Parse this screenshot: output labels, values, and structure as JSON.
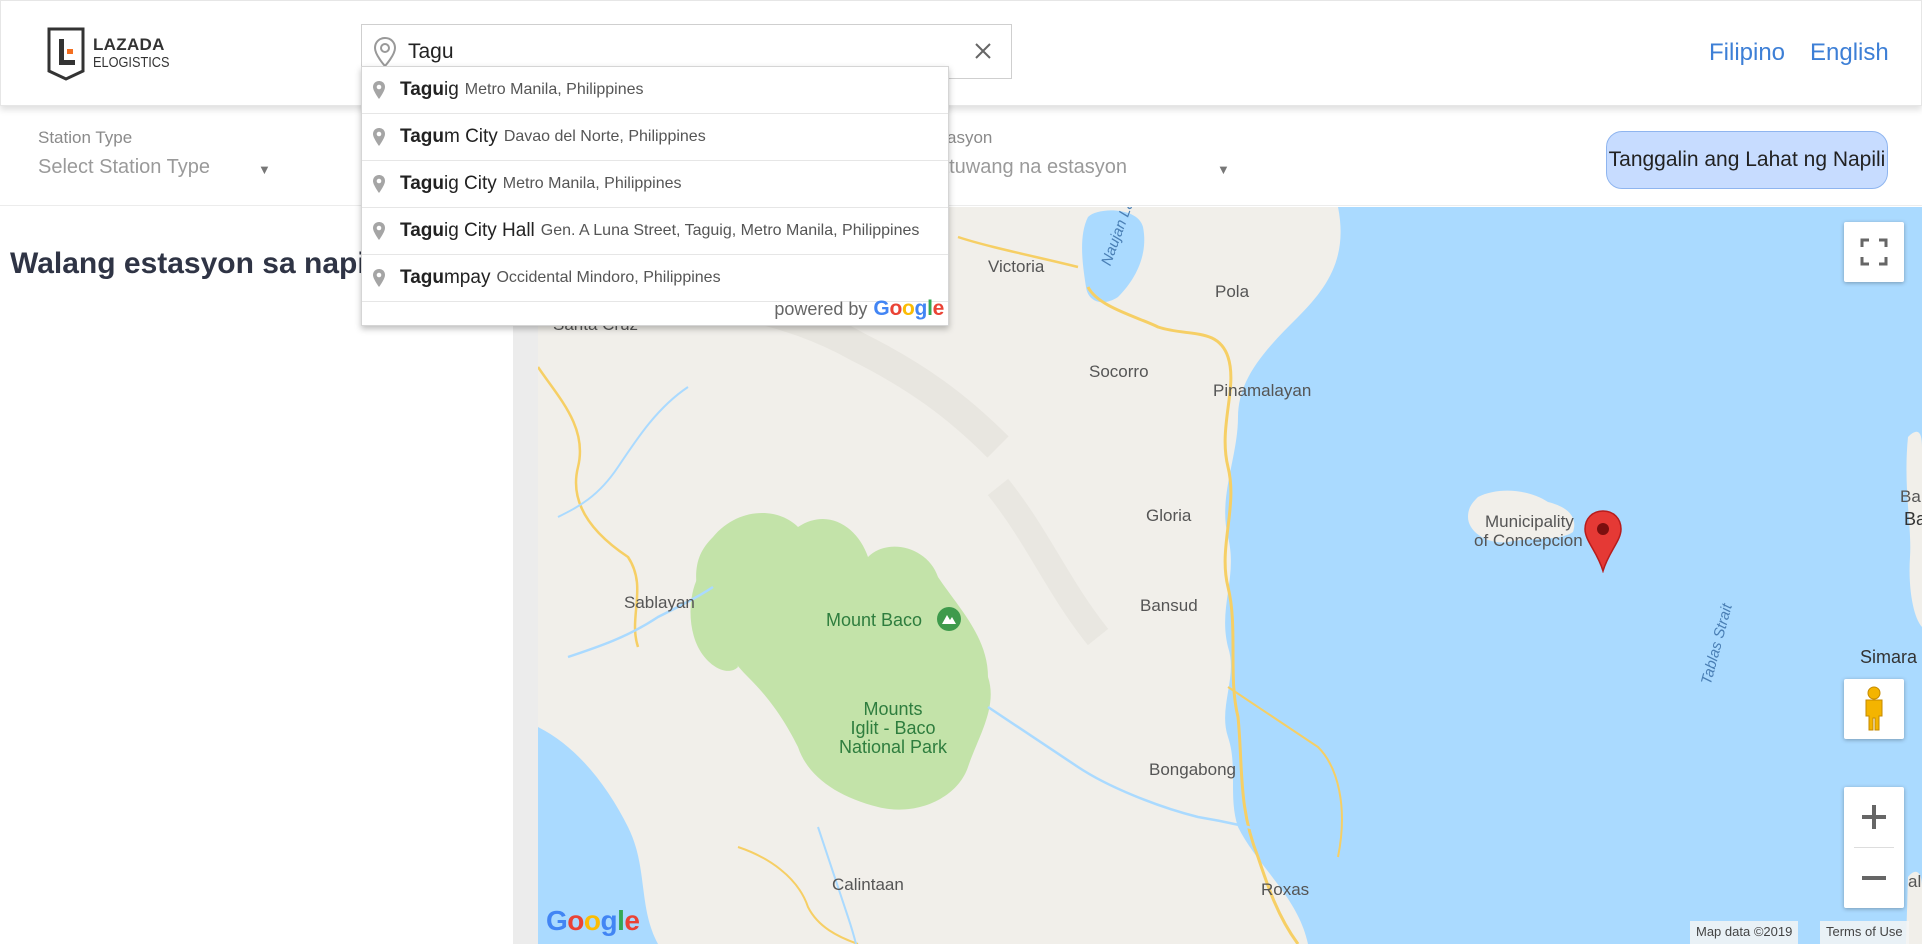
{
  "header": {
    "logo_line1": "LAZADA",
    "logo_line2": "ELOGISTICS",
    "search_value": "Tagu",
    "lang_filipino": "Filipino",
    "lang_english": "English"
  },
  "filters": {
    "station_type_label": "Station Type",
    "station_type_value": "Select Station Type",
    "station_status_label_fragment": "asyon",
    "station_status_value_fragment": "atuwang na estasyon",
    "clear_all_label": "Tanggalin ang Lahat ng Napili"
  },
  "left_panel": {
    "no_station_text": "Walang estasyon sa napi"
  },
  "suggestions": [
    {
      "match": "Tagu",
      "rest": "ig",
      "secondary": "Metro Manila, Philippines"
    },
    {
      "match": "Tagu",
      "rest": "m City",
      "secondary": "Davao del Norte, Philippines"
    },
    {
      "match": "Tagu",
      "rest": "ig City",
      "secondary": "Metro Manila, Philippines"
    },
    {
      "match": "Tagu",
      "rest": "ig City Hall",
      "secondary": "Gen. A Luna Street, Taguig, Metro Manila, Philippines"
    },
    {
      "match": "Tagu",
      "rest": "mpay",
      "secondary": "Occidental Mindoro, Philippines"
    }
  ],
  "powered_by": "powered by",
  "powered_google": "Google",
  "map": {
    "labels": {
      "victoria": "Victoria",
      "naujan_lake": "Naujan Lak",
      "pola": "Pola",
      "santa_cruz": "Santa Cruz",
      "socorro": "Socorro",
      "pinamalayan": "Pinamalayan",
      "gloria": "Gloria",
      "municipality": "Municipality",
      "of_concepcion": "of Concepcion",
      "ba": "Ba",
      "banton": "Banto",
      "sablayan": "Sablayan",
      "mount_baco": "Mount Baco",
      "bansud": "Bansud",
      "tablas_strait": "Tablas Strait",
      "simara": "Simara",
      "mounts_iglit_1": "Mounts",
      "mounts_iglit_2": "Iglit - Baco",
      "mounts_iglit_3": "National Park",
      "bongabong": "Bongabong",
      "calintaan": "Calintaan",
      "roxas": "Roxas",
      "al": "al"
    },
    "google_logo": "Google",
    "map_data": "Map data ©2019",
    "terms": "Terms of Use"
  },
  "colors": {
    "accent_blue": "#3d7fd6",
    "clear_button_bg": "#c7dcff",
    "water": "#aadaff",
    "park": "#c3e3a9",
    "marker": "#e53935"
  }
}
